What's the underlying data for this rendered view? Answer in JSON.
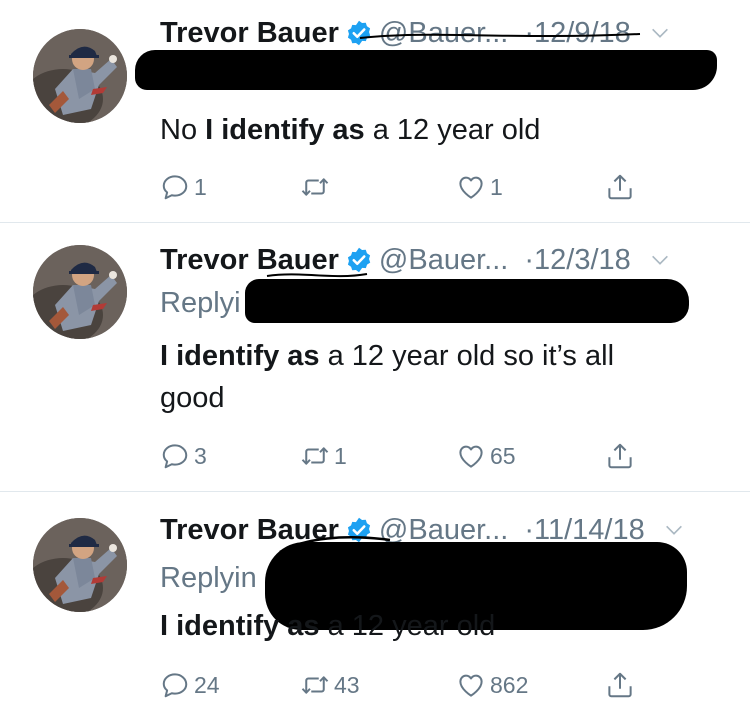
{
  "tweets": [
    {
      "name": "Trevor Bauer",
      "handle": "@Bauer...",
      "dot": "·",
      "date": "12/9/18",
      "replying": "",
      "text_parts": [
        "No ",
        "I identify as",
        " a 12 year old"
      ],
      "replies": "1",
      "retweets": "",
      "likes": "1"
    },
    {
      "name": "Trevor Bauer",
      "handle": "@Bauer...",
      "dot": "·",
      "date": "12/3/18",
      "replying": "Replyi",
      "text_parts": [
        "",
        "I identify as",
        " a 12 year old so it’s all",
        "good"
      ],
      "replies": "3",
      "retweets": "1",
      "likes": "65"
    },
    {
      "name": "Trevor Bauer",
      "handle": "@Bauer...",
      "dot": "·",
      "date": "11/14/18",
      "replying": "Replyin",
      "text_parts": [
        "",
        "I identify as",
        " a 12 year old"
      ],
      "replies": "24",
      "retweets": "43",
      "likes": "862"
    }
  ],
  "icons": {
    "reply": "reply-icon",
    "retweet": "retweet-icon",
    "like": "heart-icon",
    "share": "share-icon",
    "verified": "verified-badge-icon",
    "menu": "chevron-down-icon"
  },
  "colors": {
    "text": "#14171a",
    "secondary": "#657786",
    "verified": "#1da1f2",
    "divider": "#e1e8ed",
    "redaction": "#000000"
  }
}
